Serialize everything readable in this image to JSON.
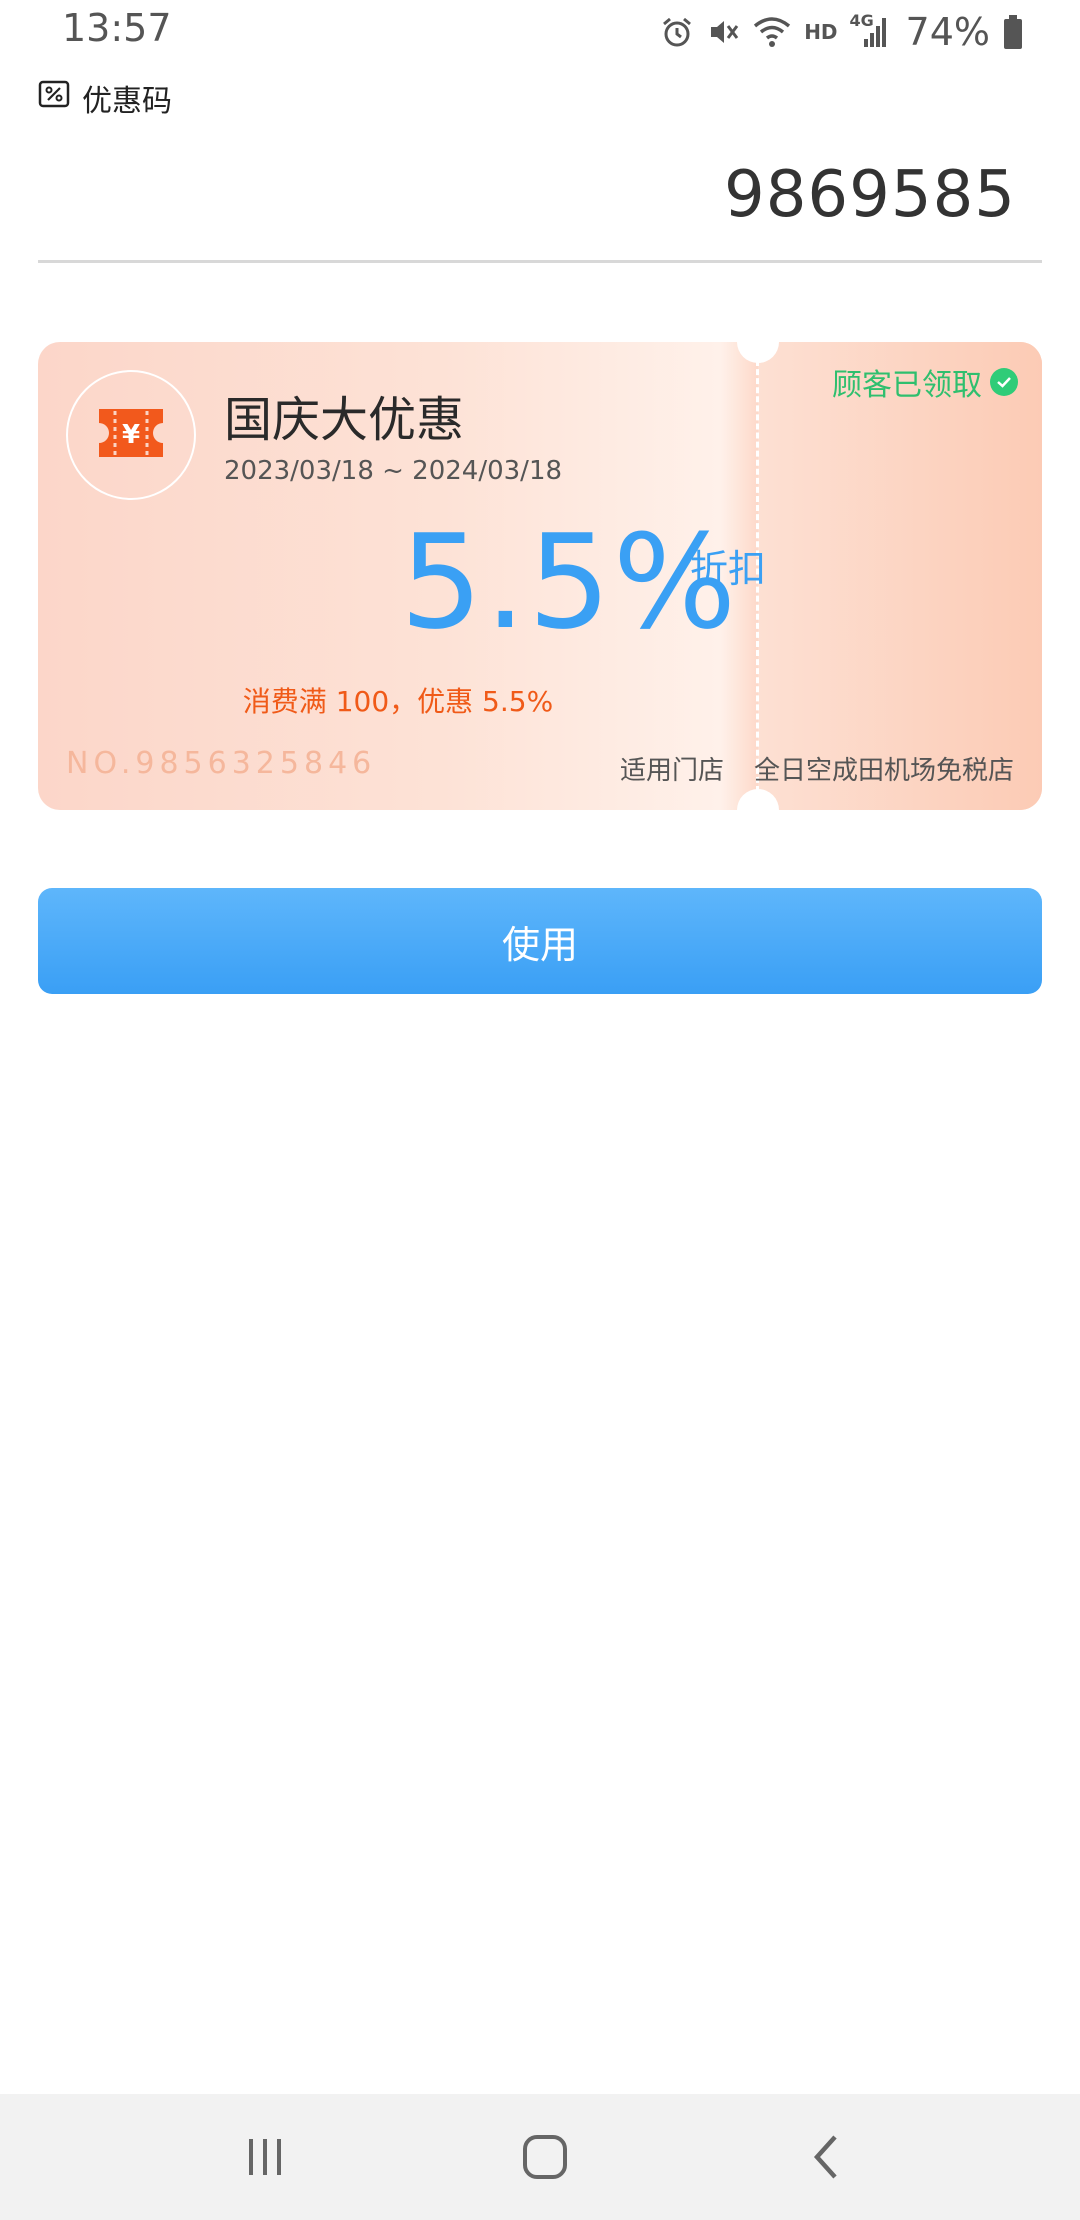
{
  "status_bar": {
    "time": "13:57",
    "network_label": "HD",
    "network_type": "4G",
    "battery": "74%",
    "icons": [
      "alarm-icon",
      "mute-icon",
      "wifi-icon",
      "signal-icon",
      "battery-icon"
    ]
  },
  "section": {
    "label": "优惠码",
    "icon": "coupon-code-icon"
  },
  "code_input": {
    "value": "9869585"
  },
  "coupon": {
    "icon": "ticket-yen-icon",
    "title": "国庆大优惠",
    "date_range": "2023/03/18 ~ 2024/03/18",
    "discount_value": "5.5%",
    "discount_unit": "折扣",
    "condition": "消费满 100，优惠 5.5%",
    "number": "NO.9856325846",
    "store_label": "适用门店",
    "store_name": "全日空成田机场免税店",
    "status": "顾客已领取",
    "colors": {
      "accent_blue": "#3aa0f4",
      "condition_orange": "#f05a18",
      "status_green": "#2fbf6e",
      "icon_orange": "#f2591c"
    }
  },
  "actions": {
    "use_label": "使用"
  },
  "nav_bar": {
    "icons": [
      "recent-apps-icon",
      "home-icon",
      "back-icon"
    ]
  }
}
